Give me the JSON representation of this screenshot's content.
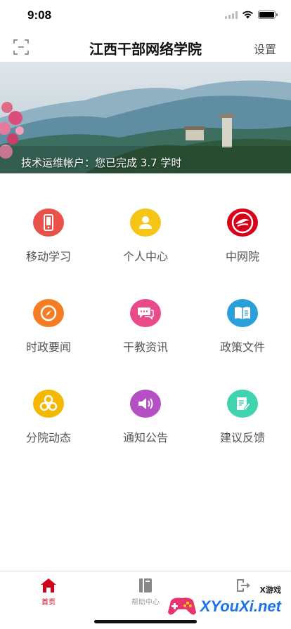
{
  "status_bar": {
    "time": "9:08"
  },
  "nav": {
    "title": "江西干部网络学院",
    "settings_label": "设置"
  },
  "banner": {
    "caption": "技术运维帐户：您已完成 3.7 学时"
  },
  "grid": [
    {
      "label": "移动学习",
      "icon": "phone-icon",
      "color": "#e9524a"
    },
    {
      "label": "个人中心",
      "icon": "user-icon",
      "color": "#f5c518"
    },
    {
      "label": "中网院",
      "icon": "china-academy-logo-icon",
      "color": "#d9001b"
    },
    {
      "label": "时政要闻",
      "icon": "compass-icon",
      "color": "#f57c22"
    },
    {
      "label": "干教资讯",
      "icon": "chat-bubbles-icon",
      "color": "#e84a8a"
    },
    {
      "label": "政策文件",
      "icon": "book-icon",
      "color": "#2b9fd9"
    },
    {
      "label": "分院动态",
      "icon": "hexagons-icon",
      "color": "#f5b800"
    },
    {
      "label": "通知公告",
      "icon": "speaker-icon",
      "color": "#b44fc4"
    },
    {
      "label": "建议反馈",
      "icon": "edit-note-icon",
      "color": "#3fd3b0"
    }
  ],
  "tabs": [
    {
      "label": "首页",
      "icon": "home-icon",
      "active": true
    },
    {
      "label": "帮助中心",
      "icon": "help-book-icon",
      "active": false
    },
    {
      "label": "",
      "icon": "logout-icon",
      "active": false
    }
  ],
  "watermark": {
    "text": "XYouXi.net",
    "tag": "X游戏"
  },
  "colors": {
    "accent": "#d0021b",
    "inactive_tab": "#999999"
  }
}
